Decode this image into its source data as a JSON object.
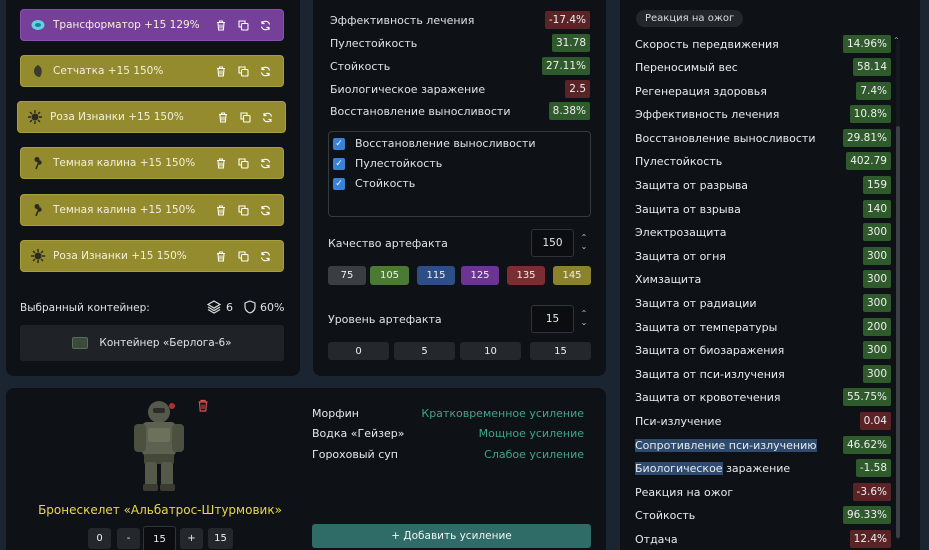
{
  "artifacts": [
    {
      "name": "Трансформатор",
      "level": "+15",
      "quality": "129%",
      "style": "purple",
      "icon": "transformer-icon"
    },
    {
      "name": "Сетчатка",
      "level": "+15",
      "quality": "150%",
      "style": "olive",
      "icon": "retina-icon"
    },
    {
      "name": "Роза Изнанки",
      "level": "+15",
      "quality": "150%",
      "style": "olive",
      "icon": "rose-icon"
    },
    {
      "name": "Темная калина",
      "level": "+15",
      "quality": "150%",
      "style": "olive",
      "icon": "viburnum-icon"
    },
    {
      "name": "Темная калина",
      "level": "+15",
      "quality": "150%",
      "style": "olive",
      "icon": "viburnum-icon"
    },
    {
      "name": "Роза Изнанки",
      "level": "+15",
      "quality": "150%",
      "style": "olive",
      "icon": "rose-icon"
    }
  ],
  "container": {
    "label": "Выбранный контейнер:",
    "slots": "6",
    "protection": "60%",
    "name": "Контейнер «Берлога-6»"
  },
  "artifact_stats": [
    {
      "name": "Эффективность лечения",
      "value": "-17.4%",
      "tone": "red"
    },
    {
      "name": "Пулестойкость",
      "value": "31.78",
      "tone": "green"
    },
    {
      "name": "Стойкость",
      "value": "27.11%",
      "tone": "green"
    },
    {
      "name": "Биологическое заражение",
      "value": "2.5",
      "tone": "red"
    },
    {
      "name": "Восстановление выносливости",
      "value": "8.38%",
      "tone": "green"
    }
  ],
  "checkboxes": [
    {
      "label": "Восстановление выносливости",
      "checked": true
    },
    {
      "label": "Пулестойкость",
      "checked": true
    },
    {
      "label": "Стойкость",
      "checked": true
    }
  ],
  "quality": {
    "label": "Качество артефакта",
    "value": "150",
    "presets": [
      {
        "label": "75",
        "color": "#3a3d42"
      },
      {
        "label": "105",
        "color": "#4a7a33"
      },
      {
        "label": "115",
        "color": "#2c4f86"
      },
      {
        "label": "125",
        "color": "#6c3592"
      },
      {
        "label": "135",
        "color": "#7a2e31"
      },
      {
        "label": "145",
        "color": "#8a822c"
      }
    ]
  },
  "level": {
    "label": "Уровень артефакта",
    "value": "15",
    "presets": [
      "0",
      "5",
      "10",
      "15"
    ]
  },
  "armor": {
    "name": "Бронескелет «Альбатрос-Штурмовик»",
    "stepper": {
      "zero": "0",
      "minus": "-",
      "value": "15",
      "plus": "+",
      "max": "15"
    }
  },
  "boosts": [
    {
      "name": "Морфин",
      "effect": "Кратковременное усиление"
    },
    {
      "name": "Водка «Гейзер»",
      "effect": "Мощное усиление"
    },
    {
      "name": "Гороховый суп",
      "effect": "Слабое усиление"
    }
  ],
  "add_boost_label": "+ Добавить усиление",
  "tooltip": "Реакция на ожог",
  "totals": [
    {
      "name": "Скорость передвижения",
      "value": "14.96%",
      "tone": "green"
    },
    {
      "name": "Переносимый вес",
      "value": "58.14",
      "tone": "green"
    },
    {
      "name": "Регенерация здоровья",
      "value": "7.4%",
      "tone": "green"
    },
    {
      "name": "Эффективность лечения",
      "value": "10.8%",
      "tone": "green"
    },
    {
      "name": "Восстановление выносливости",
      "value": "29.81%",
      "tone": "green"
    },
    {
      "name": "Пулестойкость",
      "value": "402.79",
      "tone": "green"
    },
    {
      "name": "Защита от разрыва",
      "value": "159",
      "tone": "green"
    },
    {
      "name": "Защита от взрыва",
      "value": "140",
      "tone": "green"
    },
    {
      "name": "Электрозащита",
      "value": "300",
      "tone": "green"
    },
    {
      "name": "Защита от огня",
      "value": "300",
      "tone": "green"
    },
    {
      "name": "Химзащита",
      "value": "300",
      "tone": "green"
    },
    {
      "name": "Защита от радиации",
      "value": "300",
      "tone": "green"
    },
    {
      "name": "Защита от температуры",
      "value": "200",
      "tone": "green"
    },
    {
      "name": "Защита от биозаражения",
      "value": "300",
      "tone": "green"
    },
    {
      "name": "Защита от пси-излучения",
      "value": "300",
      "tone": "green"
    },
    {
      "name": "Защита от кровотечения",
      "value": "55.75%",
      "tone": "green"
    },
    {
      "name": "Пси-излучение",
      "value": "0.04",
      "tone": "red"
    },
    {
      "name": "Сопротивление пси-излучению",
      "value": "46.62%",
      "tone": "green"
    },
    {
      "name": "Биологическое заражение",
      "value": "-1.58",
      "tone": "green"
    },
    {
      "name": "Реакция на ожог",
      "value": "-3.6%",
      "tone": "red"
    },
    {
      "name": "Стойкость",
      "value": "96.33%",
      "tone": "green"
    },
    {
      "name": "Отдача",
      "value": "12.4%",
      "tone": "red"
    }
  ]
}
